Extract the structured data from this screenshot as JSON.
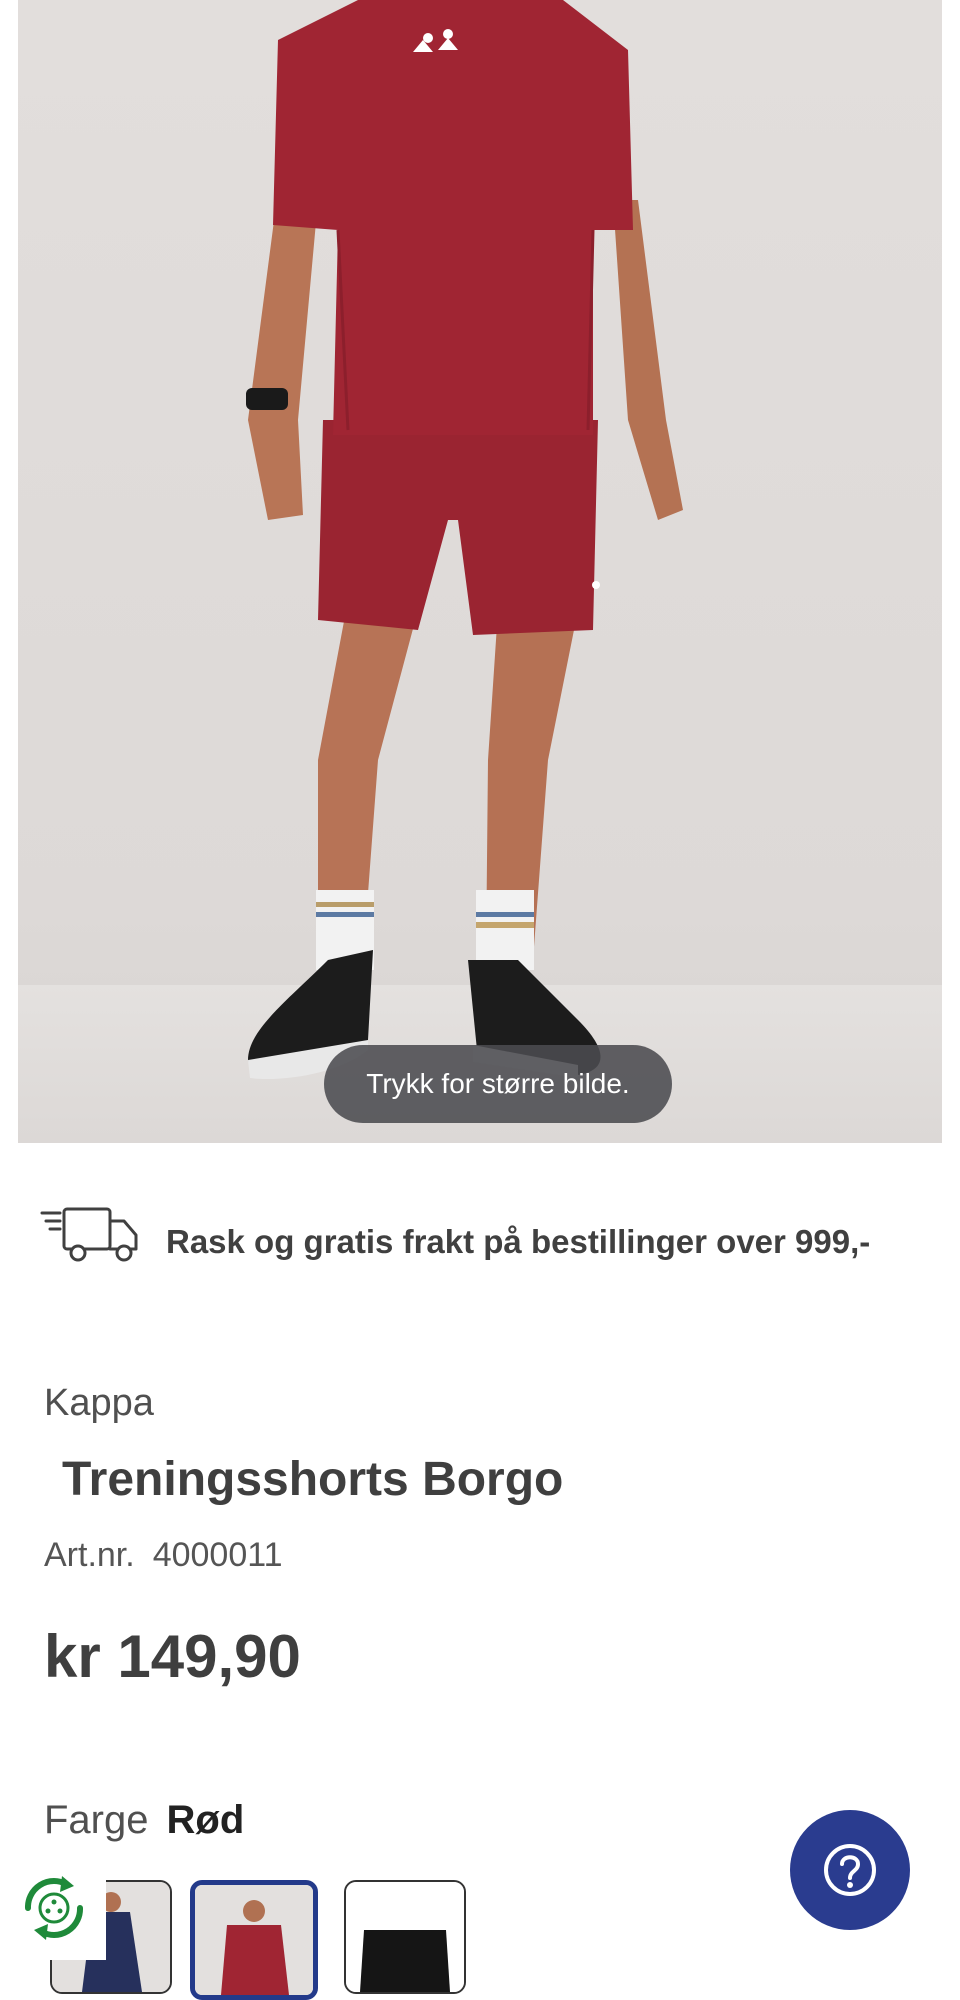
{
  "product_image": {
    "zoom_hint": "Trykk for større bilde.",
    "logo_text": "Kappa"
  },
  "shipping": {
    "text": "Rask og gratis frakt på bestillinger over 999,-",
    "icon": "delivery-truck-icon"
  },
  "product": {
    "brand": "Kappa",
    "name": "Treningsshorts Borgo",
    "artnr_label": "Art.nr.",
    "artnr_value": "4000011",
    "price": "kr 149,90"
  },
  "color": {
    "label": "Farge",
    "selected": "Rød",
    "swatches": [
      "blå",
      "rød",
      "svart"
    ]
  },
  "help": {
    "icon": "question-mark-icon"
  },
  "eco": {
    "icon": "recycle-eco-icon"
  },
  "colors": {
    "accent": "#2a3c8f",
    "jersey": "#9e2330",
    "text": "#404040"
  }
}
